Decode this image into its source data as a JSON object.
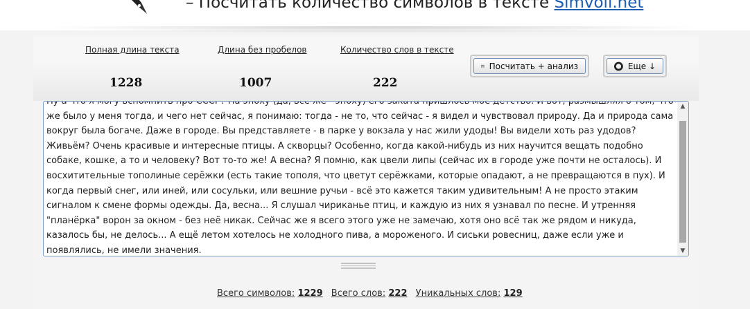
{
  "header": {
    "title": "– Посчитать количество символов в тексте",
    "site": "Simvoli.net"
  },
  "stats": {
    "full_length": {
      "label": "Полная длина текста",
      "value": "1228"
    },
    "no_spaces": {
      "label": "Длина без пробелов",
      "value": "1007"
    },
    "word_count": {
      "label": "Количество слов в тексте",
      "value": "222"
    }
  },
  "buttons": {
    "analyze_label": "Посчитать + анализ",
    "more_label": "Еще ↓"
  },
  "textarea": {
    "text": "Ну а что я могу вспомнить про СССР? На эпоху (да, все же - эпоху) его заката пришлось моё детство. И вот, размышляя о том, что же было у меня тогда, и чего нет сейчас, я понимаю: тогда - не то, что сейчас - я видел и чувствовал природу. Да и природа сама вокруг была богаче. Даже в городе. Вы представляете - в парке у вокзала у нас жили удоды! Вы видели хоть раз удодов? Живьём? Очень красивые и интересные птицы. А скворцы? Особенно, когда какой-нибудь из них научится вещать подобно собаке, кошке, а то и человеку? Вот то-то же! А весна? Я помню, как цвели липы (сейчас их в городе уже почти не осталось). И восхитительные тополиные серёжки (есть такие тополя, что цветут серёжками, которые опадают, а не превращаются в пух). И когда первый снег, или иней, или сосульки, или вешние ручьи - всё это кажется таким удивительным! А не просто этаким сигналом к смене формы одежды. Да, весна... Я слушал чириканье птиц, и каждую из них я узнавал по песне. И утренняя \"планёрка\" ворон за окном - без неё никак. Сейчас же я всего этого уже не замечаю, хотя оно всё так же рядом и никуда, казалось бы, не делось... А ещё летом хотелось не холодного пива, а мороженого. И сиськи ровесниц, даже если уже и появлялись, не имели значения."
  },
  "footer": {
    "total_chars_label": "Всего символов:",
    "total_chars_value": "1229",
    "total_words_label": "Всего слов:",
    "total_words_value": "222",
    "unique_words_label": "Уникальных слов:",
    "unique_words_value": "129"
  },
  "colors": {
    "link": "#1a5fb4",
    "textarea_border": "#7fa0c8",
    "scroll_thumb": "#a8a8a8"
  },
  "icons": {
    "logo": "pen-nib-icon",
    "analyze": "calculator-icon",
    "more": "settings-ring-icon"
  }
}
